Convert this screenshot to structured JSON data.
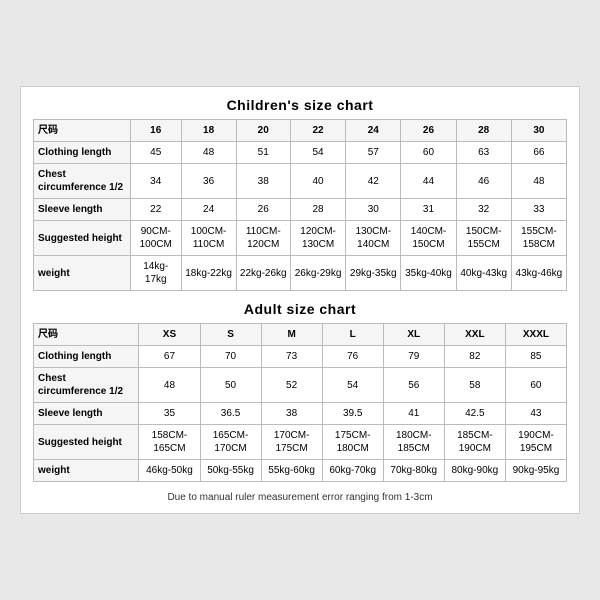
{
  "children_chart": {
    "title": "Children's size chart",
    "headers": [
      "尺码",
      "16",
      "18",
      "20",
      "22",
      "24",
      "26",
      "28",
      "30"
    ],
    "rows": [
      {
        "label": "Clothing length",
        "values": [
          "45",
          "48",
          "51",
          "54",
          "57",
          "60",
          "63",
          "66"
        ]
      },
      {
        "label": "Chest circumference 1/2",
        "values": [
          "34",
          "36",
          "38",
          "40",
          "42",
          "44",
          "46",
          "48"
        ]
      },
      {
        "label": "Sleeve length",
        "values": [
          "22",
          "24",
          "26",
          "28",
          "30",
          "31",
          "32",
          "33"
        ]
      },
      {
        "label": "Suggested height",
        "values": [
          "90CM-100CM",
          "100CM-110CM",
          "110CM-120CM",
          "120CM-130CM",
          "130CM-140CM",
          "140CM-150CM",
          "150CM-155CM",
          "155CM-158CM"
        ]
      },
      {
        "label": "weight",
        "values": [
          "14kg-17kg",
          "18kg-22kg",
          "22kg-26kg",
          "26kg-29kg",
          "29kg-35kg",
          "35kg-40kg",
          "40kg-43kg",
          "43kg-46kg"
        ]
      }
    ]
  },
  "adult_chart": {
    "title": "Adult size chart",
    "headers": [
      "尺码",
      "XS",
      "S",
      "M",
      "L",
      "XL",
      "XXL",
      "XXXL"
    ],
    "rows": [
      {
        "label": "Clothing length",
        "values": [
          "67",
          "70",
          "73",
          "76",
          "79",
          "82",
          "85"
        ]
      },
      {
        "label": "Chest circumference 1/2",
        "values": [
          "48",
          "50",
          "52",
          "54",
          "56",
          "58",
          "60"
        ]
      },
      {
        "label": "Sleeve length",
        "values": [
          "35",
          "36.5",
          "38",
          "39.5",
          "41",
          "42.5",
          "43"
        ]
      },
      {
        "label": "Suggested height",
        "values": [
          "158CM-165CM",
          "165CM-170CM",
          "170CM-175CM",
          "175CM-180CM",
          "180CM-185CM",
          "185CM-190CM",
          "190CM-195CM"
        ]
      },
      {
        "label": "weight",
        "values": [
          "46kg-50kg",
          "50kg-55kg",
          "55kg-60kg",
          "60kg-70kg",
          "70kg-80kg",
          "80kg-90kg",
          "90kg-95kg"
        ]
      }
    ]
  },
  "footer": "Due to manual ruler measurement error ranging from 1-3cm"
}
